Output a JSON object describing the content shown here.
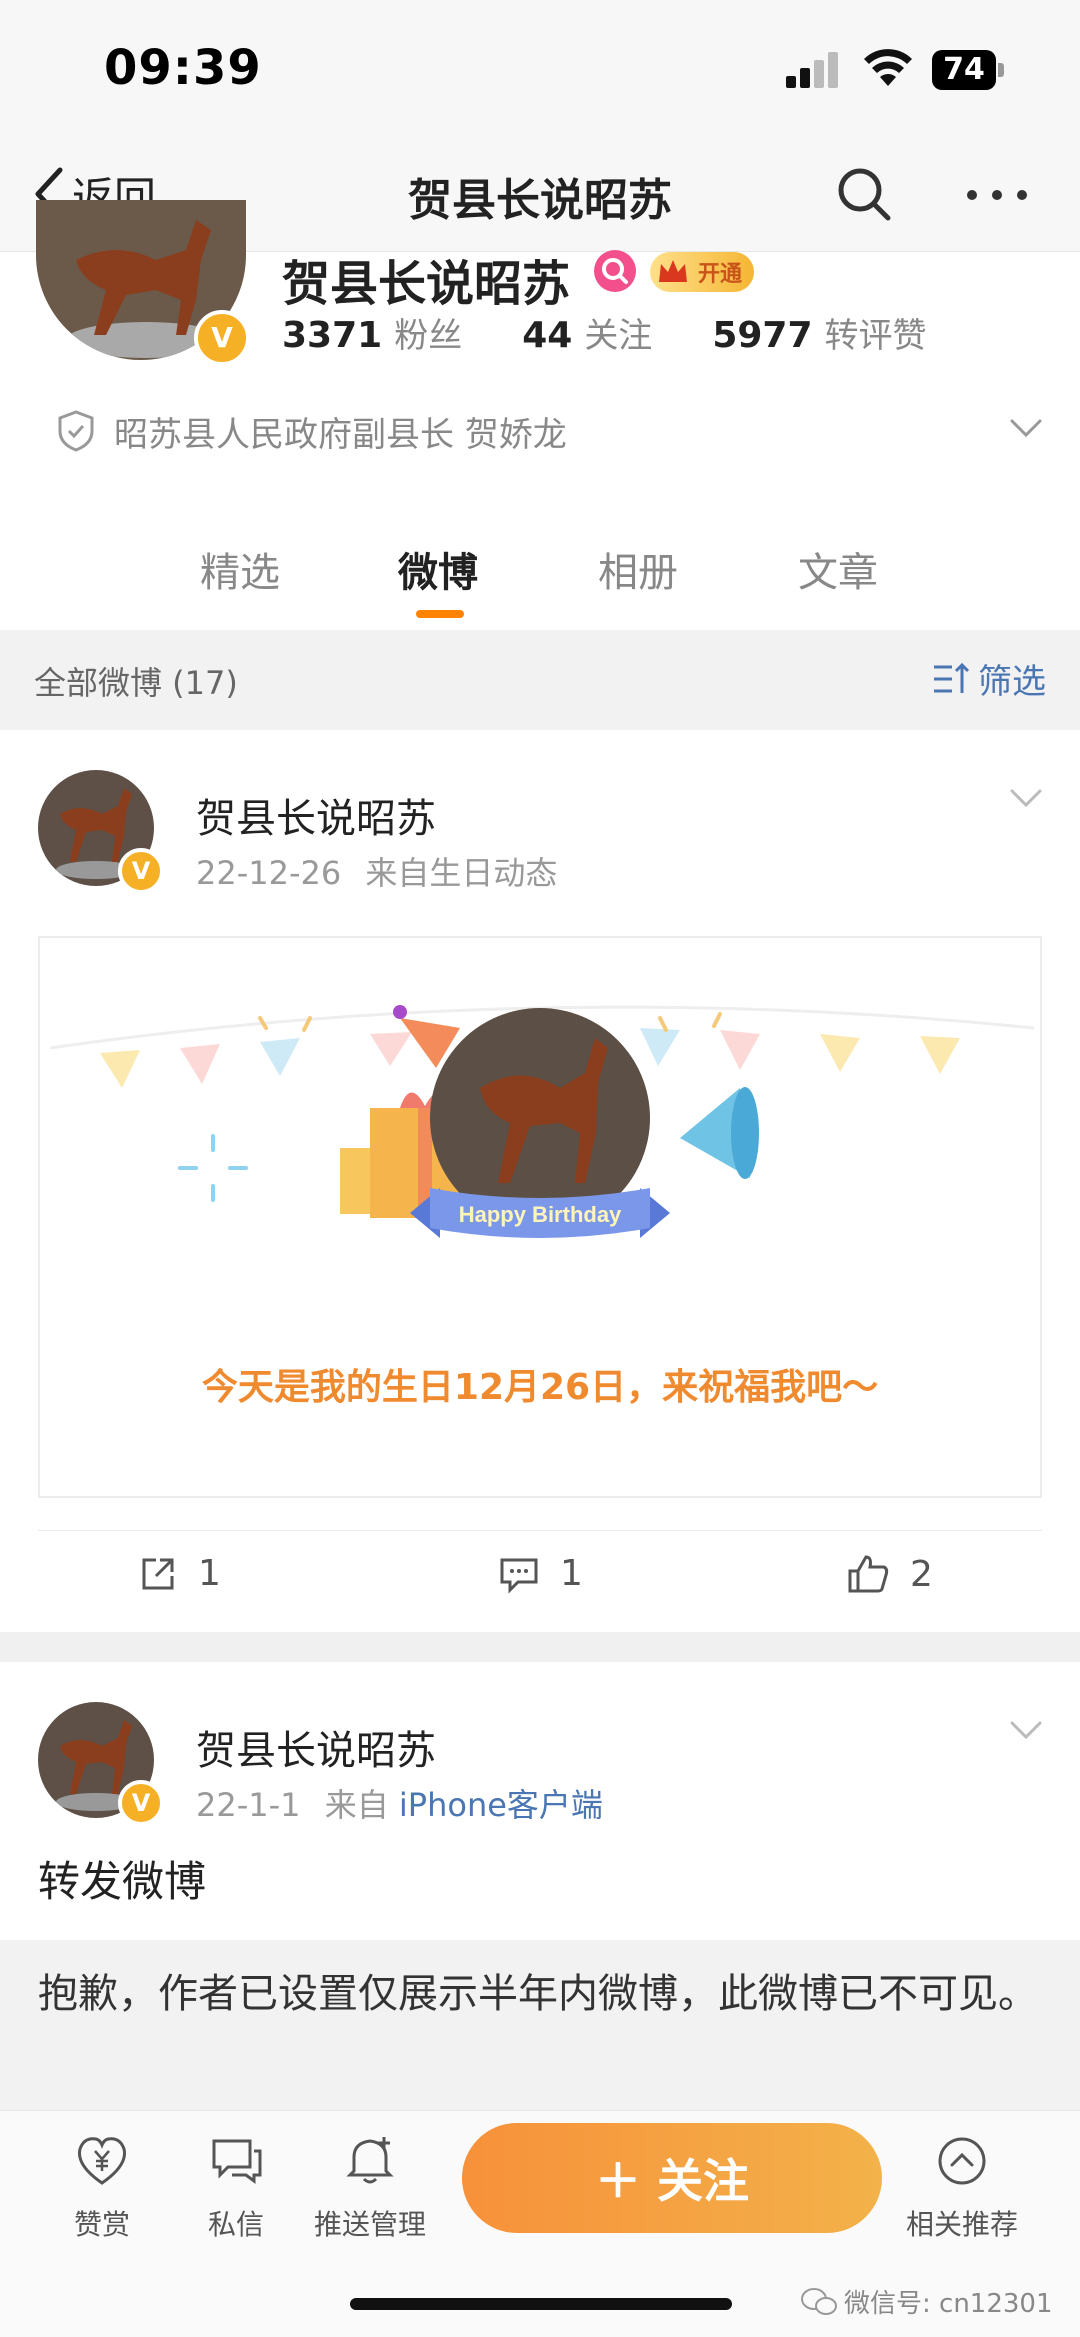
{
  "status_bar": {
    "time": "09:39",
    "battery": "74"
  },
  "nav": {
    "back_label": "返回",
    "title": "贺县长说昭苏"
  },
  "profile": {
    "name": "贺县长说昭苏",
    "vip_label": "开通",
    "stats": [
      {
        "num": "3371",
        "label": "粉丝"
      },
      {
        "num": "44",
        "label": "关注"
      },
      {
        "num": "5977",
        "label": "转评赞"
      }
    ],
    "verification": "昭苏县人民政府副县长 贺娇龙"
  },
  "tabs": [
    "精选",
    "微博",
    "相册",
    "文章"
  ],
  "active_tab": "微博",
  "filter_bar": {
    "count_label": "全部微博 (17)",
    "filter_label": "筛选"
  },
  "posts": [
    {
      "author": "贺县长说昭苏",
      "date": "22-12-26",
      "source": "来自生日动态",
      "card_banner": "Happy Birthday",
      "card_message": "今天是我的生日12月26日，来祝福我吧～",
      "reposts": "1",
      "comments": "1",
      "likes": "2"
    },
    {
      "author": "贺县长说昭苏",
      "date": "22-1-1",
      "source_prefix": "来自",
      "source_link": "iPhone客户端",
      "text": "转发微博",
      "hidden_notice": "抱歉，作者已设置仅展示半年内微博，此微博已不可见。"
    }
  ],
  "bottom_bar": {
    "items": [
      "赞赏",
      "私信",
      "推送管理",
      "相关推荐"
    ],
    "follow_label": "＋ 关注",
    "watermark": "微信号: cn12301"
  },
  "colors": {
    "accent": "#ff8200",
    "link": "#4a76b3",
    "vip": "#f6b026"
  }
}
